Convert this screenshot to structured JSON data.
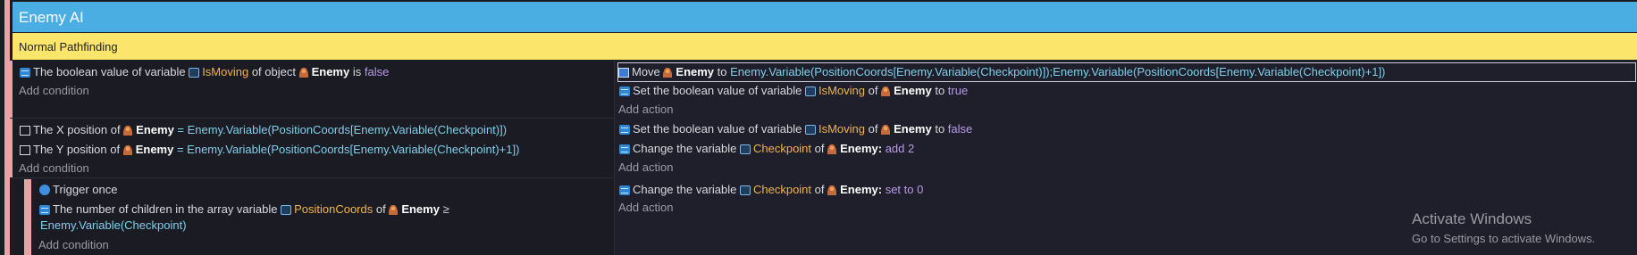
{
  "group": {
    "title": "Enemy AI"
  },
  "comment": {
    "text": "Normal Pathfinding"
  },
  "events": [
    {
      "conditions": [
        {
          "text": [
            "The boolean value of variable ",
            "IsMoving",
            " of object ",
            "Enemy",
            " is ",
            "false"
          ]
        }
      ],
      "add_condition": "Add condition",
      "actions": [
        {
          "text": [
            "Move ",
            "Enemy",
            " to ",
            "Enemy.Variable(PositionCoords[Enemy.Variable(Checkpoint)]);Enemy.Variable(PositionCoords[Enemy.Variable(Checkpoint)+1])"
          ]
        },
        {
          "text": [
            "Set the boolean value of variable ",
            "IsMoving",
            " of ",
            "Enemy",
            " to ",
            "true"
          ]
        }
      ],
      "add_action": "Add action"
    },
    {
      "conditions": [
        {
          "text": [
            "The X position of ",
            "Enemy",
            " = ",
            "Enemy.Variable(PositionCoords[Enemy.Variable(Checkpoint)])"
          ]
        },
        {
          "text": [
            "The Y position of ",
            "Enemy",
            " = ",
            "Enemy.Variable(PositionCoords[Enemy.Variable(Checkpoint)+1])"
          ]
        }
      ],
      "add_condition": "Add condition",
      "actions": [
        {
          "text": [
            "Set the boolean value of variable ",
            "IsMoving",
            " of ",
            "Enemy",
            " to ",
            "false"
          ]
        },
        {
          "text": [
            "Change the variable ",
            "Checkpoint",
            " of ",
            "Enemy:",
            " add ",
            "2"
          ]
        }
      ],
      "add_action": "Add action"
    },
    {
      "conditions": [
        {
          "text": [
            "Trigger once"
          ]
        },
        {
          "text": [
            "The number of children in the array variable ",
            "PositionCoords",
            " of ",
            "Enemy",
            " ≥"
          ]
        },
        {
          "text": [
            "Enemy.Variable(Checkpoint)"
          ]
        }
      ],
      "add_condition": "Add condition",
      "actions": [
        {
          "text": [
            "Change the variable ",
            "Checkpoint",
            " of ",
            "Enemy:",
            " set to ",
            "0"
          ]
        }
      ],
      "add_action": "Add action"
    }
  ],
  "watermark": {
    "title": "Activate Windows",
    "subtitle": "Go to Settings to activate Windows."
  }
}
